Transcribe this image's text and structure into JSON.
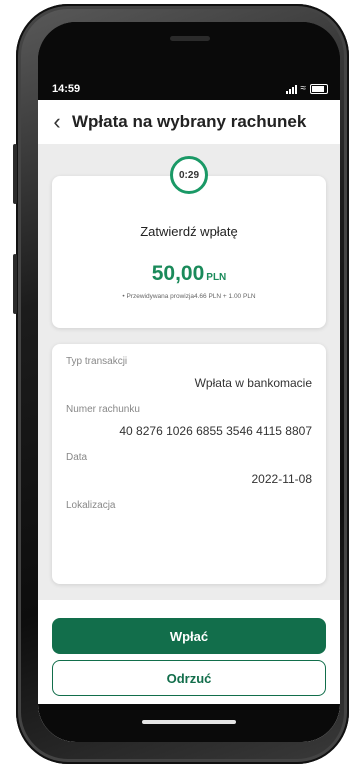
{
  "status_bar": {
    "time": "14:59"
  },
  "header": {
    "back_icon": "chevron-left-icon",
    "title": "Wpłata na wybrany rachunek"
  },
  "confirmation": {
    "timer": "0:29",
    "title": "Zatwierdź wpłatę",
    "amount": "50,00",
    "currency": "PLN",
    "commission_note": "• Przewidywana prowizja4.66 PLN + 1.00 PLN"
  },
  "details": {
    "transaction_type_label": "Typ transakcji",
    "transaction_type_value": "Wpłata w bankomacie",
    "account_number_label": "Numer rachunku",
    "account_number_value": "40 8276 1026 6855 3546 4115 8807",
    "date_label": "Data",
    "date_value": "2022-11-08",
    "location_label": "Lokalizacja"
  },
  "actions": {
    "confirm_label": "Wpłać",
    "reject_label": "Odrzuć"
  },
  "colors": {
    "accent": "#126e4b",
    "amount": "#1a8a5a",
    "timer_ring": "#1a9966"
  }
}
